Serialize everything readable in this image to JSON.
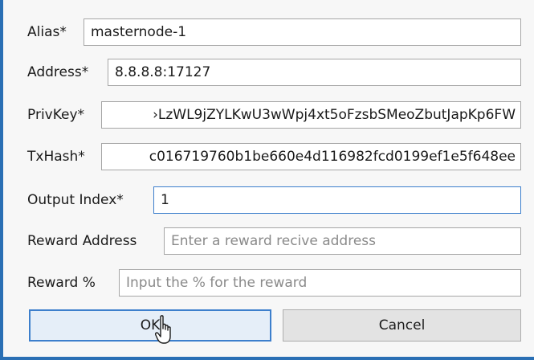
{
  "form": {
    "alias": {
      "label": "Alias*",
      "value": "masternode-1"
    },
    "address": {
      "label": "Address*",
      "value": "8.8.8.8:17127"
    },
    "privkey": {
      "label": "PrivKey*",
      "value": "›LzWL9jZYLKwU3wWpj4xt5oFzsbSMeoZbutJapKp6FW"
    },
    "txhash": {
      "label": "TxHash*",
      "value": "c016719760b1be660e4d116982fcd0199ef1e5f648ee"
    },
    "output_index": {
      "label": "Output Index*",
      "value": "1"
    },
    "reward_address": {
      "label": "Reward Address",
      "placeholder": "Enter a reward recive address"
    },
    "reward_percent": {
      "label": "Reward %",
      "placeholder": "Input the % for the reward"
    }
  },
  "buttons": {
    "ok_label": "OK",
    "cancel_label": "Cancel"
  },
  "colors": {
    "accent": "#3d7fcc",
    "window_border": "#2a6fb4"
  }
}
